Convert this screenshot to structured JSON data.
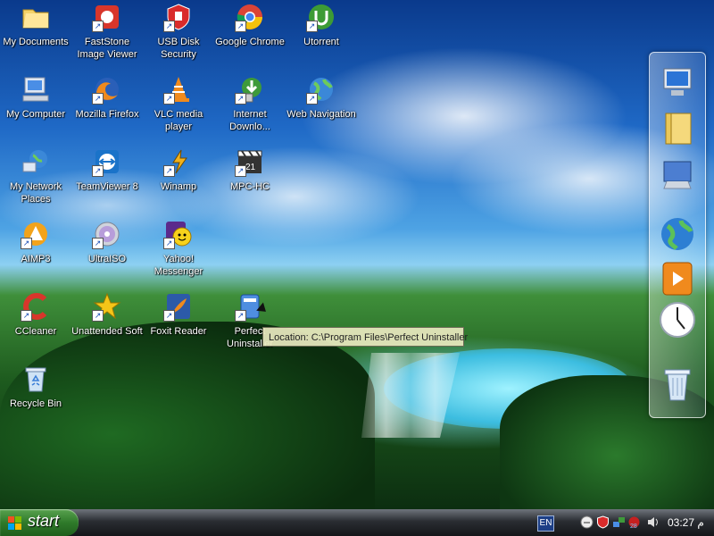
{
  "desktop": {
    "icons": [
      {
        "label": "My Documents",
        "icon": "folder-icon"
      },
      {
        "label": "FastStone Image Viewer",
        "icon": "faststone-icon"
      },
      {
        "label": "USB Disk Security",
        "icon": "usb-shield-icon"
      },
      {
        "label": "Google Chrome",
        "icon": "chrome-icon"
      },
      {
        "label": "Utorrent",
        "icon": "utorrent-icon"
      },
      {
        "label": "My Computer",
        "icon": "computer-icon"
      },
      {
        "label": "Mozilla Firefox",
        "icon": "firefox-icon"
      },
      {
        "label": "VLC media player",
        "icon": "vlc-cone-icon"
      },
      {
        "label": "Internet Downlo...",
        "icon": "download-manager-icon"
      },
      {
        "label": "Web Navigation",
        "icon": "globe-icon"
      },
      {
        "label": "My Network Places",
        "icon": "network-icon"
      },
      {
        "label": "TeamViewer 8",
        "icon": "teamviewer-icon"
      },
      {
        "label": "Winamp",
        "icon": "winamp-icon"
      },
      {
        "label": "MPC-HC",
        "icon": "film-clapper-icon"
      },
      {
        "label": "AIMP3",
        "icon": "aimp-icon"
      },
      {
        "label": "UltraISO",
        "icon": "disc-icon"
      },
      {
        "label": "Yahoo! Messenger",
        "icon": "yahoo-smiley-icon"
      },
      {
        "label": "CCleaner",
        "icon": "ccleaner-icon"
      },
      {
        "label": "Unattended Soft",
        "icon": "star-icon"
      },
      {
        "label": "Foxit Reader",
        "icon": "foxit-icon"
      },
      {
        "label": "Perfect Uninstaller",
        "icon": "uninstaller-icon"
      },
      {
        "label": "Recycle Bin",
        "icon": "recycle-bin-icon"
      }
    ],
    "tooltip": "Location: C:\\Program Files\\Perfect Uninstaller"
  },
  "dock": {
    "items": [
      "monitor-icon",
      "folder-icon",
      "control-panel-icon",
      "globe-icon",
      "media-player-icon",
      "clock-icon",
      "trash-icon"
    ]
  },
  "taskbar": {
    "start_label": "start",
    "language": "EN",
    "tray_icons": [
      "tray-smiley-icon",
      "tray-shield-icon",
      "tray-network-icon",
      "tray-antivirus-icon",
      "tray-volume-icon"
    ],
    "clock": "03:27 م"
  }
}
